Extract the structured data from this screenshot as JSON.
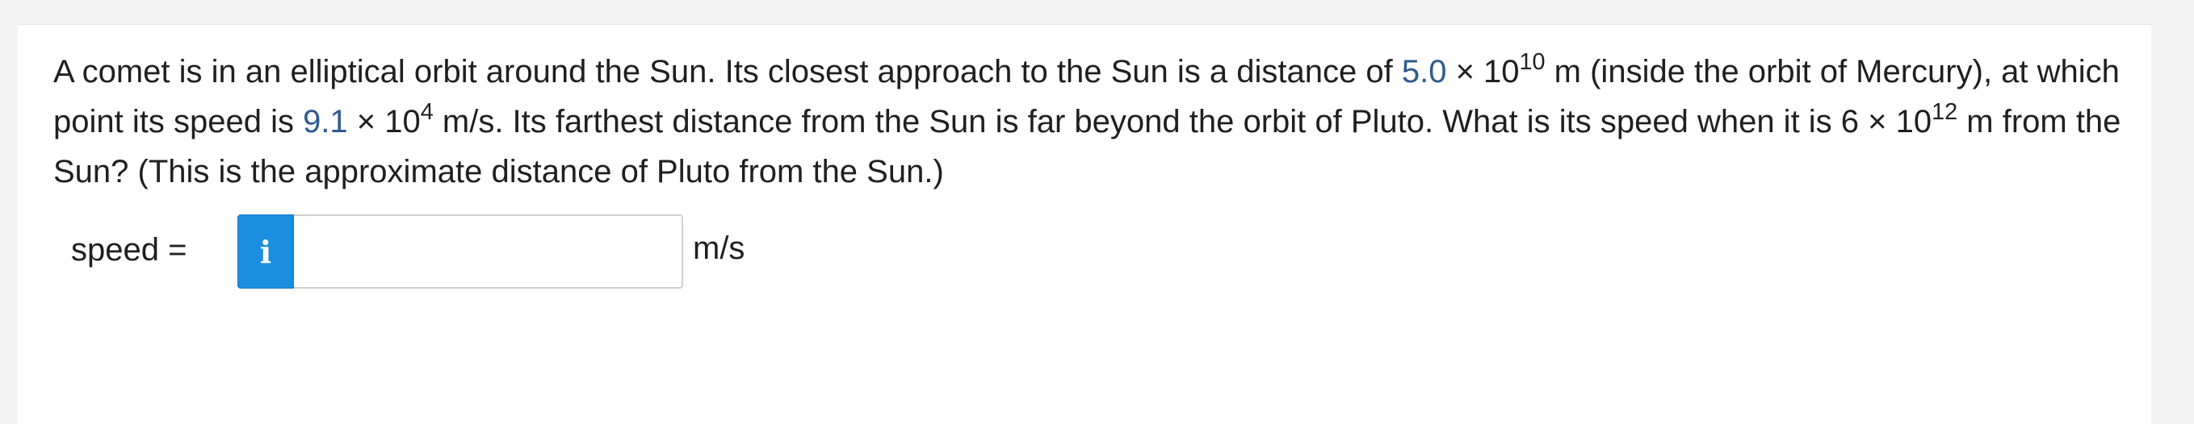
{
  "question": {
    "part1": "A comet is in an elliptical orbit around the Sun. Its closest approach to the Sun is a distance of ",
    "closest_distance": {
      "mantissa": "5.0",
      "times": " × 10",
      "exponent": "10"
    },
    "part2": " m (inside the orbit of Mercury), at which point its speed is ",
    "speed_at_closest": {
      "mantissa": "9.1",
      "times": " × 10",
      "exponent": "4"
    },
    "part3": " m/s. Its farthest distance from the Sun is far beyond the orbit of Pluto. What is its speed when it is 6 × 10",
    "pluto_exponent": "12",
    "part4": " m from the Sun? (This is the approximate distance of Pluto from the Sun.)"
  },
  "answer": {
    "label": "speed =",
    "info_glyph": "i",
    "value": "",
    "placeholder": "",
    "unit": "m/s"
  },
  "colors": {
    "value_highlight": "#2e5a8f",
    "info_badge": "#1b8ee0"
  }
}
